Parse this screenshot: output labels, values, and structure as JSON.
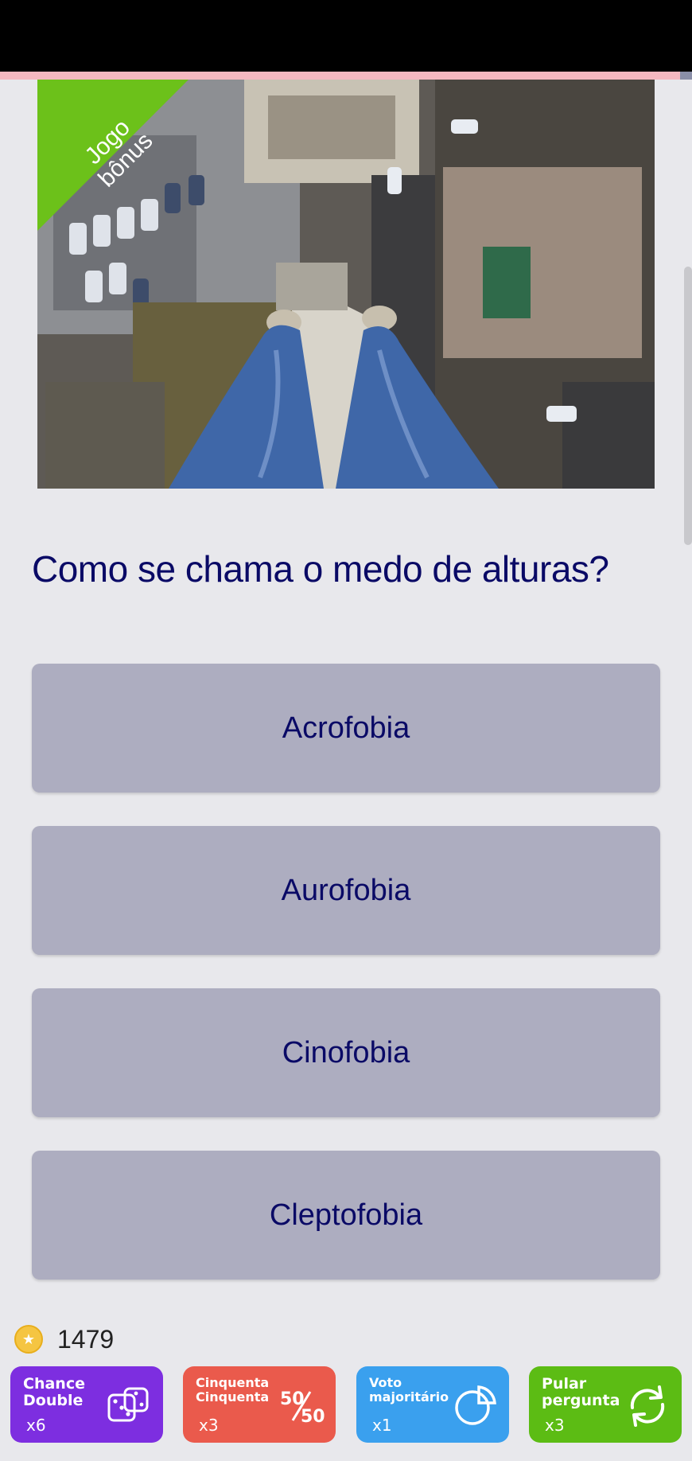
{
  "bonus_label": "Jogo bônus",
  "question": "Como se chama o medo de alturas?",
  "answers": [
    "Acrofobia",
    "Aurofobia",
    "Cinofobia",
    "Cleptofobia"
  ],
  "coins": "1479",
  "powerups": [
    {
      "label": "Chance Double",
      "count": "x6",
      "icon": "dice-icon",
      "color": "#7d2ee0"
    },
    {
      "label": "Cinquenta Cinquenta",
      "count": "x3",
      "icon": "fifty-fifty-icon",
      "color": "#ea5a4c"
    },
    {
      "label": "Voto majoritário",
      "count": "x1",
      "icon": "pie-chart-icon",
      "color": "#3aa0ee"
    },
    {
      "label": "Pular pergunta",
      "count": "x3",
      "icon": "refresh-icon",
      "color": "#5cbc14"
    }
  ],
  "fifty_icon_text": "50/50",
  "colors": {
    "accent_text": "#0a0a66",
    "answer_bg": "#adadc0",
    "bonus_green": "#6cc11a",
    "progress": "#f5b8c0"
  }
}
